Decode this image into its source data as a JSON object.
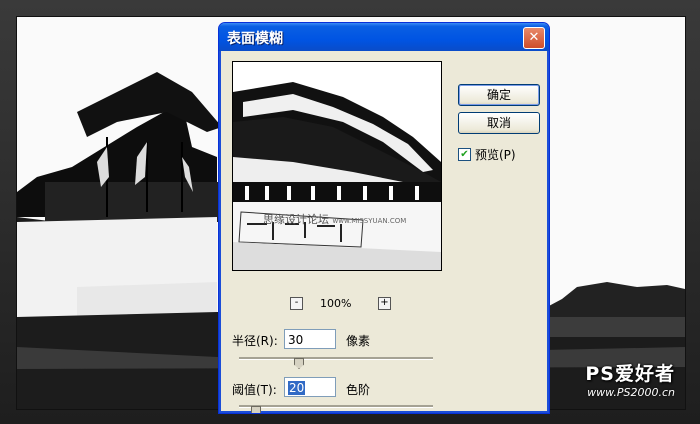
{
  "dialog": {
    "title": "表面模糊",
    "ok_label": "确定",
    "cancel_label": "取消",
    "preview_label": "预览(P)",
    "preview_checked": true,
    "zoom": {
      "minus": "-",
      "plus": "+",
      "level": "100%"
    },
    "preview_watermark": {
      "cn": "思缘设计论坛",
      "url": "www.MISSYUAN.COM"
    },
    "radius": {
      "label": "半径(R):",
      "value": "30",
      "unit": "像素",
      "slider_position": 0.3
    },
    "threshold": {
      "label": "阈值(T):",
      "value": "20",
      "unit": "色阶",
      "slider_position": 0.08
    }
  },
  "watermark": {
    "brand": "PS爱好者",
    "url": "www.PS2000.cn"
  },
  "colors": {
    "titlebar": "#0054e3",
    "dialog_bg": "#ece9d8",
    "close": "#cf4d2a",
    "check": "#21a121"
  }
}
